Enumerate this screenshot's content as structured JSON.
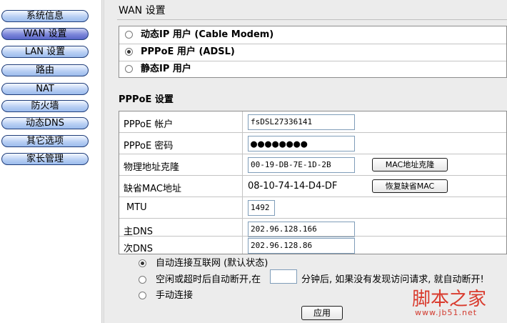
{
  "sidebar": {
    "items": [
      {
        "label": "系统信息",
        "active": false
      },
      {
        "label": "WAN 设置",
        "active": true
      },
      {
        "label": "LAN 设置",
        "active": false
      },
      {
        "label": "路由",
        "active": false
      },
      {
        "label": "NAT",
        "active": false
      },
      {
        "label": "防火墙",
        "active": false
      },
      {
        "label": "动态DNS",
        "active": false
      },
      {
        "label": "其它选项",
        "active": false
      },
      {
        "label": "家长管理",
        "active": false
      }
    ]
  },
  "wan": {
    "title": "WAN 设置",
    "modes": [
      {
        "label": "动态IP 用户 (Cable Modem)",
        "selected": false
      },
      {
        "label": "PPPoE 用户 (ADSL)",
        "selected": true
      },
      {
        "label": "静态IP 用户",
        "selected": false
      }
    ]
  },
  "pppoe": {
    "title": "PPPoE 设置",
    "account_label": "PPPoE 帐户",
    "account_value": "fsDSL27336141",
    "password_label": "PPPoE 密码",
    "password_value": "●●●●●●●●",
    "mac_clone_label": "物理地址克隆",
    "mac_clone_value": "00-19-DB-7E-1D-2B",
    "mac_clone_button": "MAC地址克隆",
    "default_mac_label": "缺省MAC地址",
    "default_mac_value": "08-10-74-14-D4-DF",
    "restore_mac_button": "恢复缺省MAC",
    "mtu_label": "MTU",
    "mtu_value": "1492",
    "primary_dns_label": "主DNS",
    "primary_dns_value": "202.96.128.166",
    "secondary_dns_label": "次DNS",
    "secondary_dns_value": "202.96.128.86"
  },
  "connect": {
    "options": [
      {
        "label": "自动连接互联网 (默认状态)",
        "selected": true
      },
      {
        "label_before": "空闲或超时后自动断开,在",
        "label_after": "分钟后, 如果没有发现访问请求, 就自动断开!",
        "selected": false
      },
      {
        "label": "手动连接",
        "selected": false
      }
    ],
    "idle_minutes": ""
  },
  "apply_button": "应用",
  "watermark": {
    "main": "脚本之家",
    "url": "www.jb51.net"
  }
}
